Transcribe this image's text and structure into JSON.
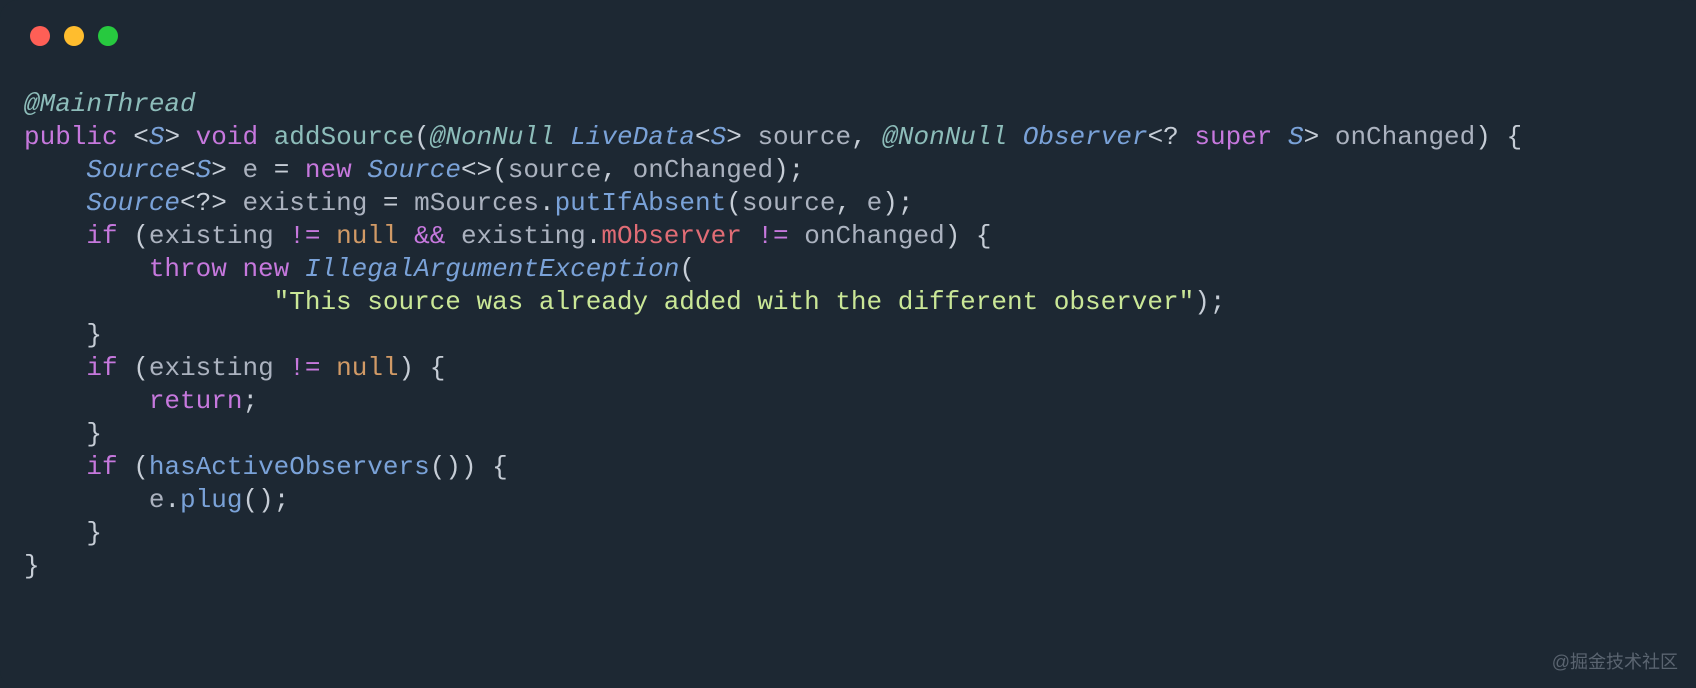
{
  "watermark": "@掘金技术社区",
  "code": {
    "line1": {
      "annotation": "@MainThread"
    },
    "line2": {
      "kw_public": "public",
      "gen_open": "<",
      "gen_S": "S",
      "gen_close": ">",
      "kw_void": "void",
      "method": "addSource",
      "paren_open": "(",
      "ann_nonnull1": "@NonNull",
      "type_livedata": "LiveData",
      "ld_open": "<",
      "ld_s": "S",
      "ld_close": ">",
      "param_source": "source",
      "comma1": ", ",
      "ann_nonnull2": "@NonNull",
      "type_observer": "Observer",
      "obs_open": "<",
      "wildcard": "?",
      "kw_super": "super",
      "obs_s": "S",
      "obs_close": ">",
      "param_onchanged": "onChanged",
      "paren_close": ")",
      "brace_open": " {"
    },
    "line3": {
      "type_source": "Source",
      "gen_open": "<",
      "gen_s": "S",
      "gen_close": ">",
      "var_e": "e",
      "eq": " = ",
      "kw_new": "new",
      "ctor": "Source",
      "diamond": "<>",
      "paren_open": "(",
      "arg1": "source",
      "comma": ", ",
      "arg2": "onChanged",
      "paren_close": ")",
      "semi": ";"
    },
    "line4": {
      "type_source": "Source",
      "gen_open": "<",
      "wildcard": "?",
      "gen_close": ">",
      "var_existing": "existing",
      "eq": " = ",
      "obj": "mSources",
      "dot": ".",
      "call": "putIfAbsent",
      "paren_open": "(",
      "arg1": "source",
      "comma": ", ",
      "arg2": "e",
      "paren_close": ")",
      "semi": ";"
    },
    "line5": {
      "kw_if": "if",
      "paren_open": " (",
      "var1": "existing",
      "neq1": " != ",
      "null1": "null",
      "and": " && ",
      "var2": "existing",
      "dot": ".",
      "field": "mObserver",
      "neq2": " != ",
      "var3": "onChanged",
      "paren_close": ")",
      "brace": " {"
    },
    "line6": {
      "kw_throw": "throw",
      "kw_new": "new",
      "ctor": "IllegalArgumentException",
      "paren_open": "("
    },
    "line7": {
      "str": "\"This source was already added with the different observer\"",
      "paren_close": ")",
      "semi": ";"
    },
    "line8": {
      "brace": "}"
    },
    "line9": {
      "kw_if": "if",
      "paren_open": " (",
      "var": "existing",
      "neq": " != ",
      "null": "null",
      "paren_close": ")",
      "brace": " {"
    },
    "line10": {
      "kw_return": "return",
      "semi": ";"
    },
    "line11": {
      "brace": "}"
    },
    "line12": {
      "kw_if": "if",
      "paren_open": " (",
      "call": "hasActiveObservers",
      "parens": "()",
      "paren_close": ")",
      "brace": " {"
    },
    "line13": {
      "obj": "e",
      "dot": ".",
      "call": "plug",
      "parens": "()",
      "semi": ";"
    },
    "line14": {
      "brace": "}"
    },
    "line15": {
      "brace": "}"
    }
  }
}
